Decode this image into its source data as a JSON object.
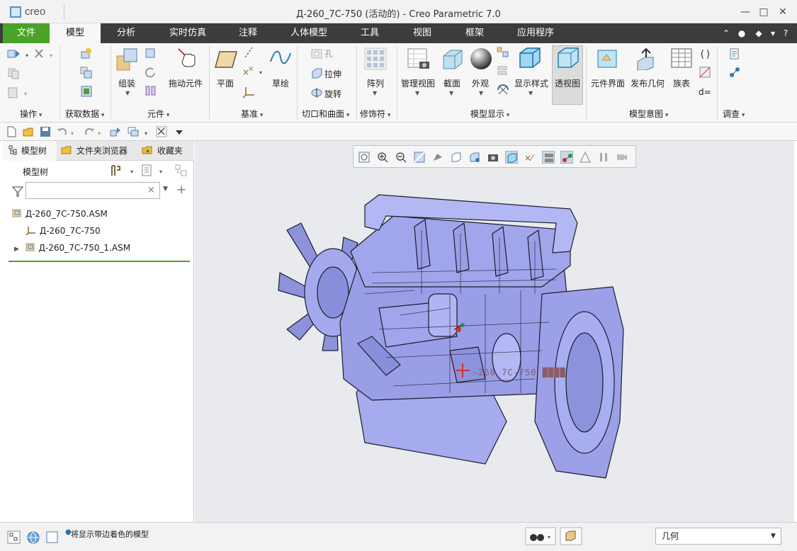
{
  "app": {
    "logo_text": "creo",
    "title": "Д-260_7С-750 (活动的) - Creo Parametric 7.0"
  },
  "window_controls": {
    "minimize": "—",
    "maximize": "□",
    "close": "✕"
  },
  "tabs": {
    "file": "文件",
    "model": "模型",
    "analysis": "分析",
    "simulation": "实时仿真",
    "annotate": "注释",
    "human": "人体模型",
    "tools": "工具",
    "view": "视图",
    "framework": "框架",
    "apps": "应用程序"
  },
  "ribbon": {
    "groups": {
      "operations": "操作",
      "get_data": "获取数据",
      "component": "元件",
      "datum": "基准",
      "cut_surface": "切口和曲面",
      "modifiers": "修饰符",
      "model_display": "模型显示",
      "model_intent": "模型意图",
      "investigate": "调查"
    },
    "buttons": {
      "assemble": "组装",
      "drag_components": "拖动元件",
      "plane": "平面",
      "sketch": "草绘",
      "hole": "孔",
      "extrude": "拉伸",
      "revolve": "旋转",
      "pattern": "阵列",
      "manage_views": "管理视图",
      "section": "截面",
      "appearance": "外观",
      "display_style": "显示样式",
      "perspective": "透视图",
      "component_interface": "元件界面",
      "publish_geometry": "发布几何",
      "family_table": "族表",
      "equals_symbol": "d="
    }
  },
  "navigator": {
    "tabs": {
      "model_tree": "模型树",
      "folder_browser": "文件夹浏览器",
      "favorites": "收藏夹"
    },
    "header_label": "模型树",
    "search": {
      "value": "",
      "placeholder": ""
    },
    "tree_items": [
      {
        "label": "Д-260_7С-750.ASM",
        "icon": "assembly-icon"
      },
      {
        "label": "Д-260_7С-750",
        "icon": "coordinate-system-icon"
      },
      {
        "label": "Д-260_7С-750_1.ASM",
        "icon": "assembly-icon"
      }
    ]
  },
  "graphics": {
    "model_label": "-260_7C-750 ████"
  },
  "status": {
    "message": "将显示带边着色的模型",
    "filter_value": "几何"
  },
  "colors": {
    "file_tab": "#49a329",
    "tab_bar": "#3c3c3c",
    "ribbon_bg": "#f7f7f7",
    "viewport_bg": "#e9eaee",
    "model_shade": "#9a9ee6",
    "model_edge": "#1c1c2e"
  }
}
